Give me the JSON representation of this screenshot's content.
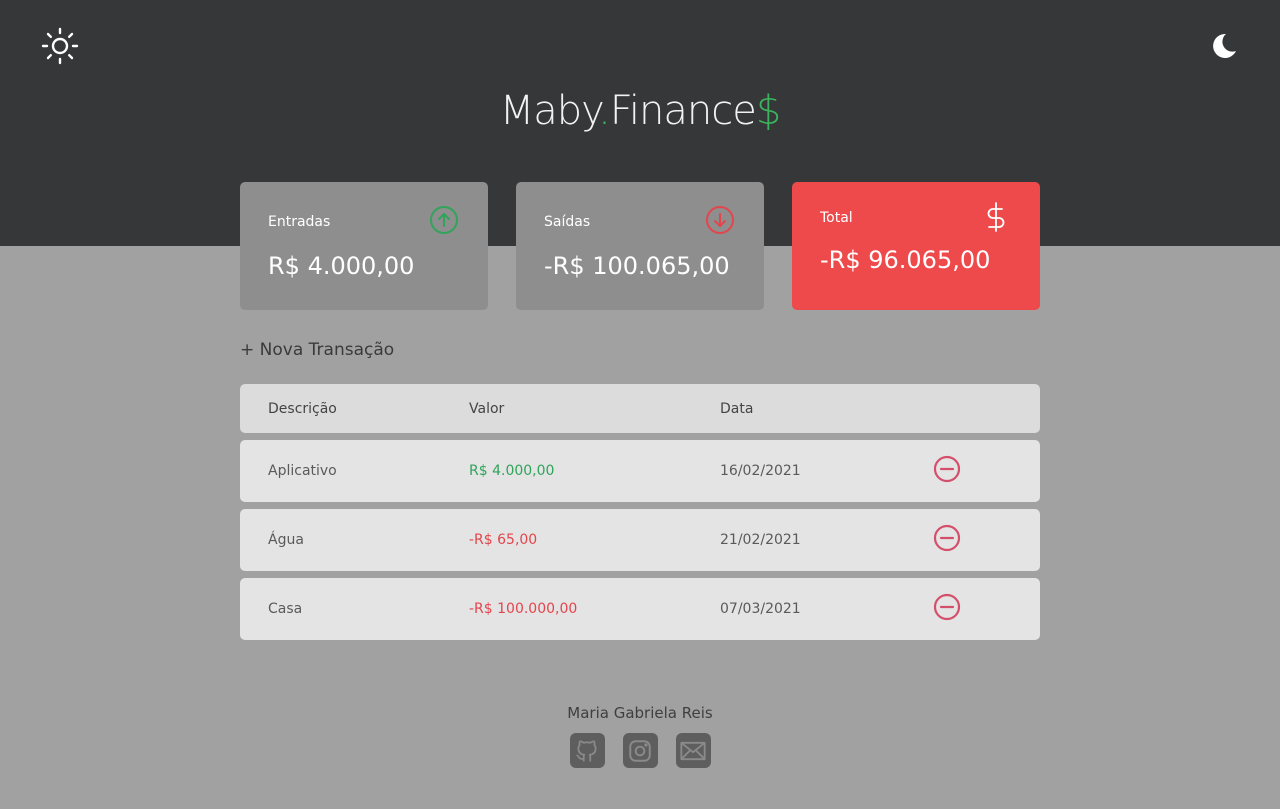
{
  "app": {
    "logo_main": "Maby",
    "logo_dot": ".",
    "logo_rest": "Finance",
    "logo_symbol": "$"
  },
  "theme": {
    "light_icon": "sun-icon",
    "dark_icon": "moon-icon"
  },
  "summary": {
    "income": {
      "title": "Entradas",
      "value": "R$ 4.000,00",
      "icon": "arrow-up-circle-icon"
    },
    "expense": {
      "title": "Saídas",
      "value": "-R$ 100.065,00",
      "icon": "arrow-down-circle-icon"
    },
    "total": {
      "title": "Total",
      "value": "-R$ 96.065,00",
      "icon": "dollar-sign-icon"
    }
  },
  "new_transaction_label": "+ Nova Transação",
  "table": {
    "headers": [
      "Descrição",
      "Valor",
      "Data"
    ],
    "rows": [
      {
        "description": "Aplicativo",
        "amount": "R$ 4.000,00",
        "date": "16/02/2021",
        "type": "income"
      },
      {
        "description": "Água",
        "amount": "-R$ 65,00",
        "date": "21/02/2021",
        "type": "expense"
      },
      {
        "description": "Casa",
        "amount": "-R$ 100.000,00",
        "date": "07/03/2021",
        "type": "expense"
      }
    ]
  },
  "footer": {
    "author": "Maria Gabriela Reis",
    "socials": [
      "github-icon",
      "instagram-icon",
      "mail-icon"
    ]
  },
  "colors": {
    "header_bg": "#363738",
    "page_bg": "#a1a1a1",
    "income_green": "#2fa45a",
    "expense_red": "#e3454c",
    "total_card": "#ef4a4b"
  }
}
